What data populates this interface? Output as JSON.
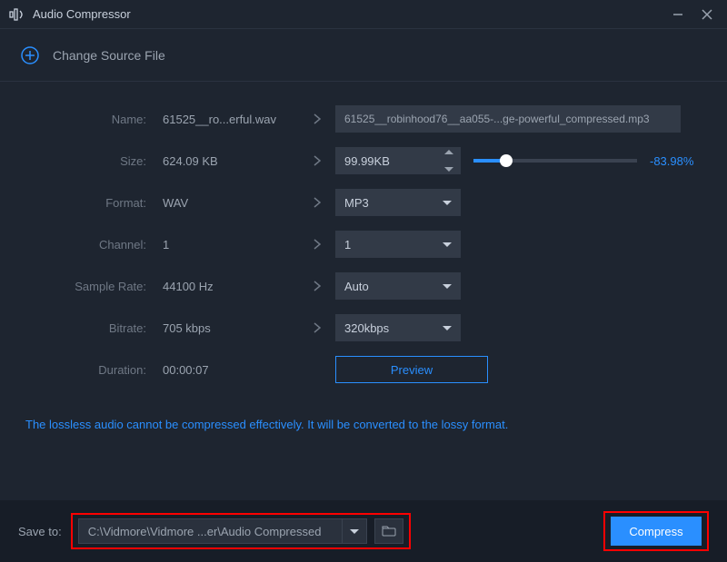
{
  "app": {
    "title": "Audio Compressor"
  },
  "source": {
    "change_label": "Change Source File"
  },
  "labels": {
    "name": "Name:",
    "size": "Size:",
    "format": "Format:",
    "channel": "Channel:",
    "sample_rate": "Sample Rate:",
    "bitrate": "Bitrate:",
    "duration": "Duration:"
  },
  "original": {
    "name": "61525__ro...erful.wav",
    "size": "624.09 KB",
    "format": "WAV",
    "channel": "1",
    "sample_rate": "44100 Hz",
    "bitrate": "705 kbps",
    "duration": "00:00:07"
  },
  "output": {
    "name": "61525__robinhood76__aa055-...ge-powerful_compressed.mp3",
    "size": "99.99KB",
    "size_reduction_pct": "-83.98%",
    "format": "MP3",
    "channel": "1",
    "sample_rate": "Auto",
    "bitrate": "320kbps"
  },
  "actions": {
    "preview": "Preview",
    "compress": "Compress"
  },
  "notice": "The lossless audio cannot be compressed effectively. It will be converted to the lossy format.",
  "save": {
    "label": "Save to:",
    "path": "C:\\Vidmore\\Vidmore ...er\\Audio Compressed"
  }
}
